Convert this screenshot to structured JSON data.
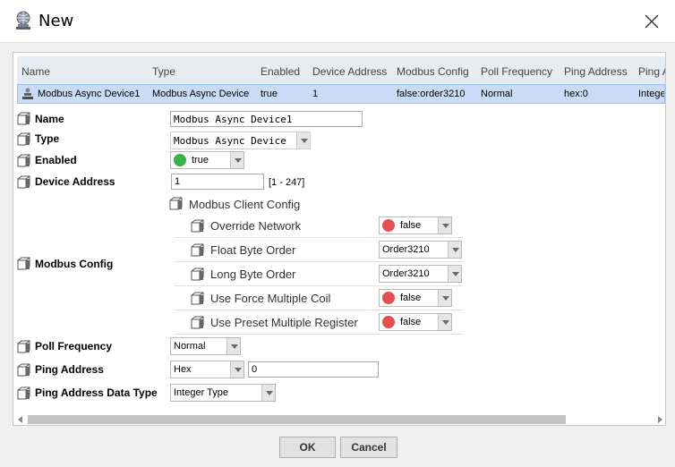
{
  "window": {
    "title": "New"
  },
  "table": {
    "columns": [
      "Name",
      "Type",
      "Enabled",
      "Device Address",
      "Modbus Config",
      "Poll Frequency",
      "Ping Address",
      "Ping A"
    ],
    "row": [
      "Modbus Async Device1",
      "Modbus Async Device",
      "true",
      "1",
      "false:order3210",
      "Normal",
      "hex:0",
      "Intege"
    ]
  },
  "props": {
    "name": {
      "label": "Name",
      "value": "Modbus Async Device1"
    },
    "type": {
      "label": "Type",
      "value": "Modbus Async Device"
    },
    "enabled": {
      "label": "Enabled",
      "value": "true"
    },
    "device_address": {
      "label": "Device Address",
      "value": "1",
      "range": "[1 - 247]"
    },
    "modbus_config": {
      "label": "Modbus Config",
      "group_label": "Modbus Client Config",
      "override_network": {
        "label": "Override Network",
        "value": "false"
      },
      "float_byte_order": {
        "label": "Float Byte Order",
        "value": "Order3210"
      },
      "long_byte_order": {
        "label": "Long Byte Order",
        "value": "Order3210"
      },
      "use_force_multiple_coil": {
        "label": "Use Force Multiple Coil",
        "value": "false"
      },
      "use_preset_multiple_register": {
        "label": "Use Preset Multiple Register",
        "value": "false"
      }
    },
    "poll_frequency": {
      "label": "Poll Frequency",
      "value": "Normal"
    },
    "ping_address": {
      "label": "Ping Address",
      "format": "Hex",
      "value": "0"
    },
    "ping_address_data_type": {
      "label": "Ping Address Data Type",
      "value": "Integer Type"
    }
  },
  "buttons": {
    "ok": "OK",
    "cancel": "Cancel"
  },
  "colors": {
    "true_dot": "#3bb149",
    "false_dot": "#e45050",
    "row_selected": "#c8ddf5",
    "header_bg": "#e6ecf1"
  },
  "icons": {
    "title": "globe-computer-icon",
    "property": "cube-icon",
    "device": "device-icon",
    "close": "close-icon"
  }
}
